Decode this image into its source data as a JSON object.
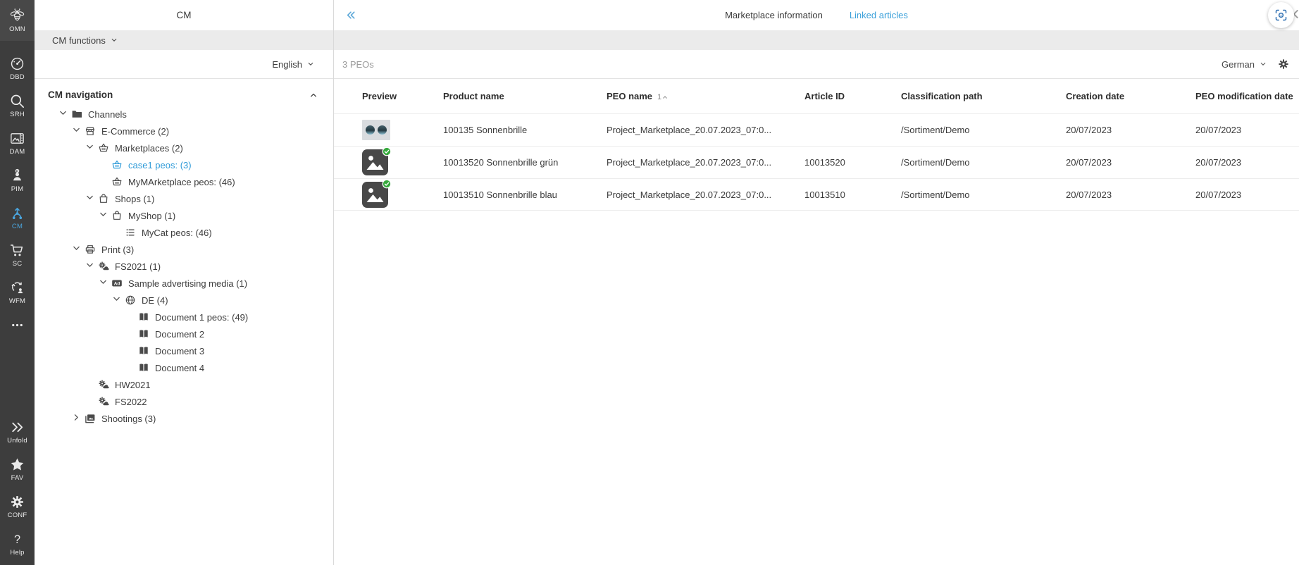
{
  "rail": {
    "top_items": [
      {
        "id": "omn",
        "label": "OMN",
        "icon": "bee-logo-icon",
        "active": false
      },
      {
        "id": "dbd",
        "label": "DBD",
        "icon": "dashboard-icon",
        "active": false
      },
      {
        "id": "srh",
        "label": "SRH",
        "icon": "search-icon",
        "active": false
      },
      {
        "id": "dam",
        "label": "DAM",
        "icon": "media-icon",
        "active": false
      },
      {
        "id": "pim",
        "label": "PIM",
        "icon": "person-icon",
        "active": false
      },
      {
        "id": "cm",
        "label": "CM",
        "icon": "hub-icon",
        "active": true
      },
      {
        "id": "sc",
        "label": "SC",
        "icon": "cart-icon",
        "active": false
      },
      {
        "id": "wfm",
        "label": "WFM",
        "icon": "workflow-icon",
        "active": false
      },
      {
        "id": "more",
        "label": "",
        "icon": "more-icon",
        "active": false
      }
    ],
    "bottom_items": [
      {
        "id": "unfold",
        "label": "Unfold",
        "icon": "unfold-icon",
        "active": false
      },
      {
        "id": "fav",
        "label": "FAV",
        "icon": "star-icon",
        "active": false
      },
      {
        "id": "conf",
        "label": "CONF",
        "icon": "gear-icon",
        "active": false
      },
      {
        "id": "help",
        "label": "Help",
        "icon": "help-icon",
        "active": false
      }
    ]
  },
  "panel": {
    "title": "CM",
    "functions_label": "CM functions",
    "language": "English",
    "nav_title": "CM navigation",
    "tree": [
      {
        "label": "Channels",
        "level": 1,
        "expander": "expanded",
        "icon": "folder-icon",
        "selected": false
      },
      {
        "label": "E-Commerce (2)",
        "level": 2,
        "expander": "expanded",
        "icon": "store-icon",
        "selected": false
      },
      {
        "label": "Marketplaces (2)",
        "level": 3,
        "expander": "expanded",
        "icon": "basket-icon",
        "selected": false
      },
      {
        "label": "case1 peos: (3)",
        "level": 4,
        "expander": "none",
        "icon": "basket-icon",
        "selected": true
      },
      {
        "label": "MyMArketplace peos: (46)",
        "level": 4,
        "expander": "none",
        "icon": "basket-icon",
        "selected": false
      },
      {
        "label": "Shops (1)",
        "level": 3,
        "expander": "expanded",
        "icon": "bag-icon",
        "selected": false
      },
      {
        "label": "MyShop (1)",
        "level": 4,
        "expander": "expanded",
        "icon": "bag-icon",
        "selected": false
      },
      {
        "label": "MyCat peos: (46)",
        "level": 5,
        "expander": "none",
        "icon": "list-icon",
        "selected": false
      },
      {
        "label": "Print (3)",
        "level": 2,
        "expander": "expanded",
        "icon": "printer-icon",
        "selected": false
      },
      {
        "label": "FS2021 (1)",
        "level": 3,
        "expander": "expanded",
        "icon": "season-icon",
        "selected": false
      },
      {
        "label": "Sample advertising media (1)",
        "level": 4,
        "expander": "expanded",
        "icon": "ad-icon",
        "selected": false
      },
      {
        "label": "DE (4)",
        "level": 5,
        "expander": "expanded",
        "icon": "globe-icon",
        "selected": false
      },
      {
        "label": "Document 1 peos: (49)",
        "level": 6,
        "expander": "none",
        "icon": "book-icon",
        "selected": false
      },
      {
        "label": "Document 2",
        "level": 6,
        "expander": "none",
        "icon": "book-icon",
        "selected": false
      },
      {
        "label": "Document 3",
        "level": 6,
        "expander": "none",
        "icon": "book-icon",
        "selected": false
      },
      {
        "label": "Document 4",
        "level": 6,
        "expander": "none",
        "icon": "book-icon",
        "selected": false
      },
      {
        "label": "HW2021",
        "level": 3,
        "expander": "none",
        "icon": "season-icon",
        "selected": false
      },
      {
        "label": "FS2022",
        "level": 3,
        "expander": "none",
        "icon": "season-icon",
        "selected": false
      },
      {
        "label": "Shootings (3)",
        "level": 2,
        "expander": "collapsed",
        "icon": "gallery-icon",
        "selected": false
      }
    ]
  },
  "main": {
    "tabs": [
      {
        "label": "Marketplace information",
        "active": true
      },
      {
        "label": "Linked articles",
        "active": false
      }
    ],
    "count_label": "3 PEOs",
    "language": "German",
    "table": {
      "columns": [
        "Preview",
        "Product name",
        "PEO name",
        "Article ID",
        "Classification path",
        "Creation date",
        "PEO modification date"
      ],
      "sort": {
        "column": "PEO name",
        "order": "1",
        "direction": "asc"
      },
      "rows": [
        {
          "preview": "sunglasses-photo-thumb",
          "verified": false,
          "product_name": "100135 Sonnenbrille",
          "peo_name": "Project_Marketplace_20.07.2023_07:0...",
          "article_id": "",
          "classification_path": "/Sortiment/Demo",
          "creation_date": "20/07/2023",
          "peo_modification_date": "20/07/2023"
        },
        {
          "preview": "image-placeholder-thumb",
          "verified": true,
          "product_name": "10013520 Sonnenbrille grün",
          "peo_name": "Project_Marketplace_20.07.2023_07:0...",
          "article_id": "10013520",
          "classification_path": "/Sortiment/Demo",
          "creation_date": "20/07/2023",
          "peo_modification_date": "20/07/2023"
        },
        {
          "preview": "image-placeholder-thumb",
          "verified": true,
          "product_name": "10013510 Sonnenbrille blau",
          "peo_name": "Project_Marketplace_20.07.2023_07:0...",
          "article_id": "10013510",
          "classification_path": "/Sortiment/Demo",
          "creation_date": "20/07/2023",
          "peo_modification_date": "20/07/2023"
        }
      ]
    }
  },
  "colors": {
    "accent_blue": "#3aa0da",
    "rail_bg": "#3d3d3d",
    "selected_text": "#2f9bd8",
    "verified_green": "#36a93c"
  }
}
